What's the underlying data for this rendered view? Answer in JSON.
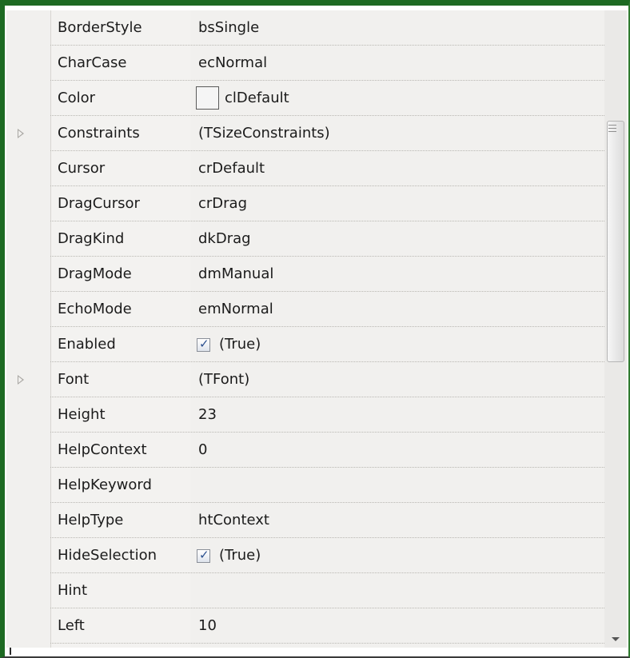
{
  "properties": [
    {
      "name": "BorderStyle",
      "value": "bsSingle",
      "kind": "text",
      "expandable": false
    },
    {
      "name": "CharCase",
      "value": "ecNormal",
      "kind": "text",
      "expandable": false
    },
    {
      "name": "Color",
      "value": "clDefault",
      "kind": "color",
      "expandable": false
    },
    {
      "name": "Constraints",
      "value": "(TSizeConstraints)",
      "kind": "text",
      "expandable": true
    },
    {
      "name": "Cursor",
      "value": "crDefault",
      "kind": "text",
      "expandable": false
    },
    {
      "name": "DragCursor",
      "value": "crDrag",
      "kind": "text",
      "expandable": false
    },
    {
      "name": "DragKind",
      "value": "dkDrag",
      "kind": "text",
      "expandable": false
    },
    {
      "name": "DragMode",
      "value": "dmManual",
      "kind": "text",
      "expandable": false
    },
    {
      "name": "EchoMode",
      "value": "emNormal",
      "kind": "text",
      "expandable": false
    },
    {
      "name": "Enabled",
      "value": "(True)",
      "kind": "checkbox",
      "checked": true,
      "expandable": false
    },
    {
      "name": "Font",
      "value": "(TFont)",
      "kind": "text",
      "expandable": true
    },
    {
      "name": "Height",
      "value": "23",
      "kind": "text",
      "expandable": false
    },
    {
      "name": "HelpContext",
      "value": "0",
      "kind": "text",
      "expandable": false
    },
    {
      "name": "HelpKeyword",
      "value": "",
      "kind": "text",
      "expandable": false
    },
    {
      "name": "HelpType",
      "value": "htContext",
      "kind": "text",
      "expandable": false
    },
    {
      "name": "HideSelection",
      "value": "(True)",
      "kind": "checkbox",
      "checked": true,
      "expandable": false
    },
    {
      "name": "Hint",
      "value": "",
      "kind": "text",
      "expandable": false
    },
    {
      "name": "Left",
      "value": "10",
      "kind": "text",
      "expandable": false
    }
  ],
  "colors": {
    "frame": "#1d6a22",
    "grid_background": "#f1f0ee",
    "text": "#1b1b1b"
  },
  "icons": {
    "expander": "triangle-right-icon",
    "scroll_grip": "grip-lines-icon",
    "scroll_down": "arrow-down-icon",
    "checkmark": "checkmark-icon"
  }
}
